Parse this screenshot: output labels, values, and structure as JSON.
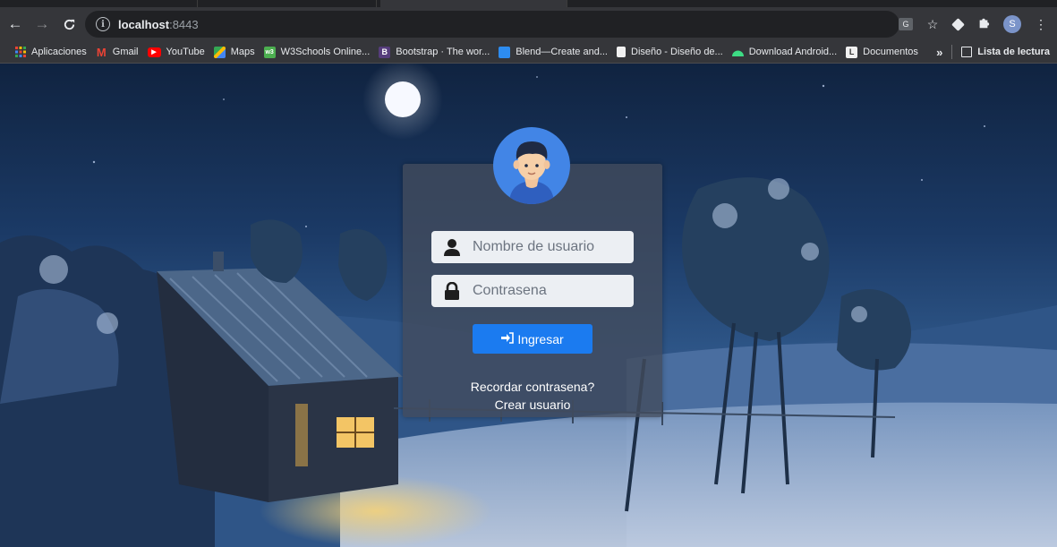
{
  "browser": {
    "url_host": "localhost",
    "url_port": ":8443",
    "profile_initial": "S",
    "bookmarks": [
      {
        "label": "Aplicaciones",
        "icon": "apps-grid-icon",
        "color": "#ea4335"
      },
      {
        "label": "Gmail",
        "icon": "gmail-icon",
        "color": "#d93025"
      },
      {
        "label": "YouTube",
        "icon": "youtube-icon",
        "color": "#ff0000"
      },
      {
        "label": "Maps",
        "icon": "maps-icon",
        "color": "#34a853"
      },
      {
        "label": "W3Schools Online...",
        "icon": "w3schools-icon",
        "color": "#4caf50"
      },
      {
        "label": "Bootstrap · The wor...",
        "icon": "bootstrap-icon",
        "color": "#563d7c"
      },
      {
        "label": "Blend—Create and...",
        "icon": "blend-icon",
        "color": "#2d8cf0"
      },
      {
        "label": "Diseño - Diseño de...",
        "icon": "page-icon",
        "color": "#ffffff"
      },
      {
        "label": "Download Android...",
        "icon": "android-icon",
        "color": "#3ddc84"
      },
      {
        "label": "Documentos",
        "icon": "docs-icon",
        "color": "#f0f0f0"
      }
    ],
    "more_label": "»",
    "reading_list_label": "Lista de lectura"
  },
  "login": {
    "username_placeholder": "Nombre de usuario",
    "password_placeholder": "Contrasena",
    "submit_label": "Ingresar",
    "forgot_label": "Recordar contrasena?",
    "register_label": "Crear usuario"
  },
  "colors": {
    "accent": "#1b7bf0",
    "avatar_bg": "#4285e6",
    "card_bg": "rgba(66,76,92,0.78)"
  }
}
